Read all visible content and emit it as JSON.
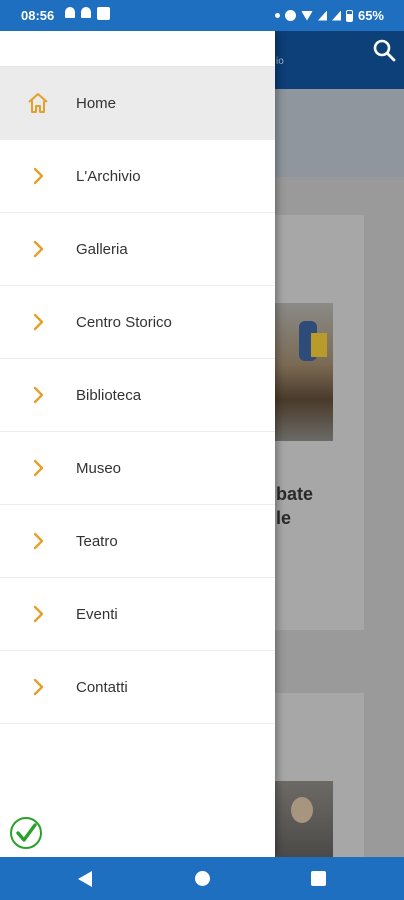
{
  "status_bar": {
    "time": "08:56",
    "battery": "65%"
  },
  "background": {
    "header_subtitle": "io",
    "card_title": "bate\nle"
  },
  "drawer": {
    "items": [
      {
        "label": "Home",
        "icon": "home-icon",
        "active": true
      },
      {
        "label": "L'Archivio",
        "icon": "chevron-right-icon"
      },
      {
        "label": "Galleria",
        "icon": "chevron-right-icon"
      },
      {
        "label": "Centro Storico",
        "icon": "chevron-right-icon"
      },
      {
        "label": "Biblioteca",
        "icon": "chevron-right-icon"
      },
      {
        "label": "Museo",
        "icon": "chevron-right-icon"
      },
      {
        "label": "Teatro",
        "icon": "chevron-right-icon"
      },
      {
        "label": "Eventi",
        "icon": "chevron-right-icon"
      },
      {
        "label": "Contatti",
        "icon": "chevron-right-icon"
      }
    ]
  },
  "colors": {
    "accent": "#e3a02a",
    "status_bar": "#1e6fbf",
    "header": "#0d3f78",
    "check": "#2aa12a"
  }
}
